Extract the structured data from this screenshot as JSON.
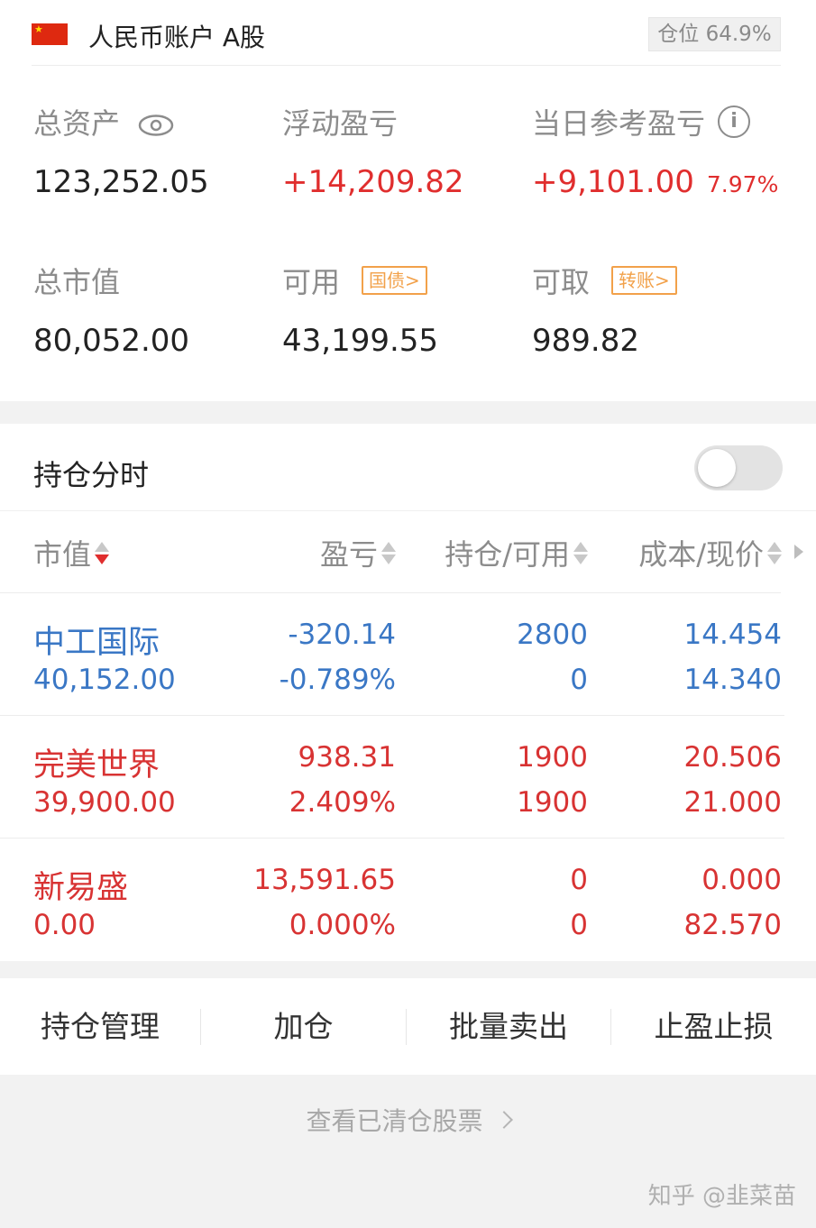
{
  "account": {
    "title": "人民币账户 A股",
    "position_badge": "仓位 64.9%",
    "flag_icon": "cn-flag-icon"
  },
  "metrics": {
    "total_assets": {
      "label": "总资产",
      "value": "123,252.05",
      "icon": "eye-icon"
    },
    "floating_pl": {
      "label": "浮动盈亏",
      "value": "+14,209.82"
    },
    "daily_pl": {
      "label": "当日参考盈亏",
      "value": "+9,101.00",
      "percent": "7.97%",
      "icon": "info-icon"
    },
    "market_value": {
      "label": "总市值",
      "value": "80,052.00"
    },
    "available": {
      "label": "可用",
      "value": "43,199.55",
      "tag": "国债>"
    },
    "withdrawable": {
      "label": "可取",
      "value": "989.82",
      "tag": "转账>"
    }
  },
  "holdings": {
    "title": "持仓分时",
    "toggle_on": false,
    "columns": [
      "市值",
      "盈亏",
      "持仓/可用",
      "成本/现价"
    ],
    "rows": [
      {
        "name": "中工国际",
        "market_value": "40,152.00",
        "pl": "-320.14",
        "pl_pct": "-0.789%",
        "qty": "2800",
        "available": "0",
        "cost": "14.454",
        "price": "14.340",
        "color": "#3a77c5"
      },
      {
        "name": "完美世界",
        "market_value": "39,900.00",
        "pl": "938.31",
        "pl_pct": "2.409%",
        "qty": "1900",
        "available": "1900",
        "cost": "20.506",
        "price": "21.000",
        "color": "#d83333"
      },
      {
        "name": "新易盛",
        "market_value": "0.00",
        "pl": "13,591.65",
        "pl_pct": "0.000%",
        "qty": "0",
        "available": "0",
        "cost": "0.000",
        "price": "82.570",
        "color": "#d83333"
      }
    ]
  },
  "actions": [
    "持仓管理",
    "加仓",
    "批量卖出",
    "止盈止损"
  ],
  "cleared_link": "查看已清仓股票",
  "watermark": "知乎 @韭菜苗",
  "colors": {
    "up": "#e02e2e",
    "down": "#3a77c5",
    "accent": "#e53935",
    "tag": "#f2a14a"
  }
}
